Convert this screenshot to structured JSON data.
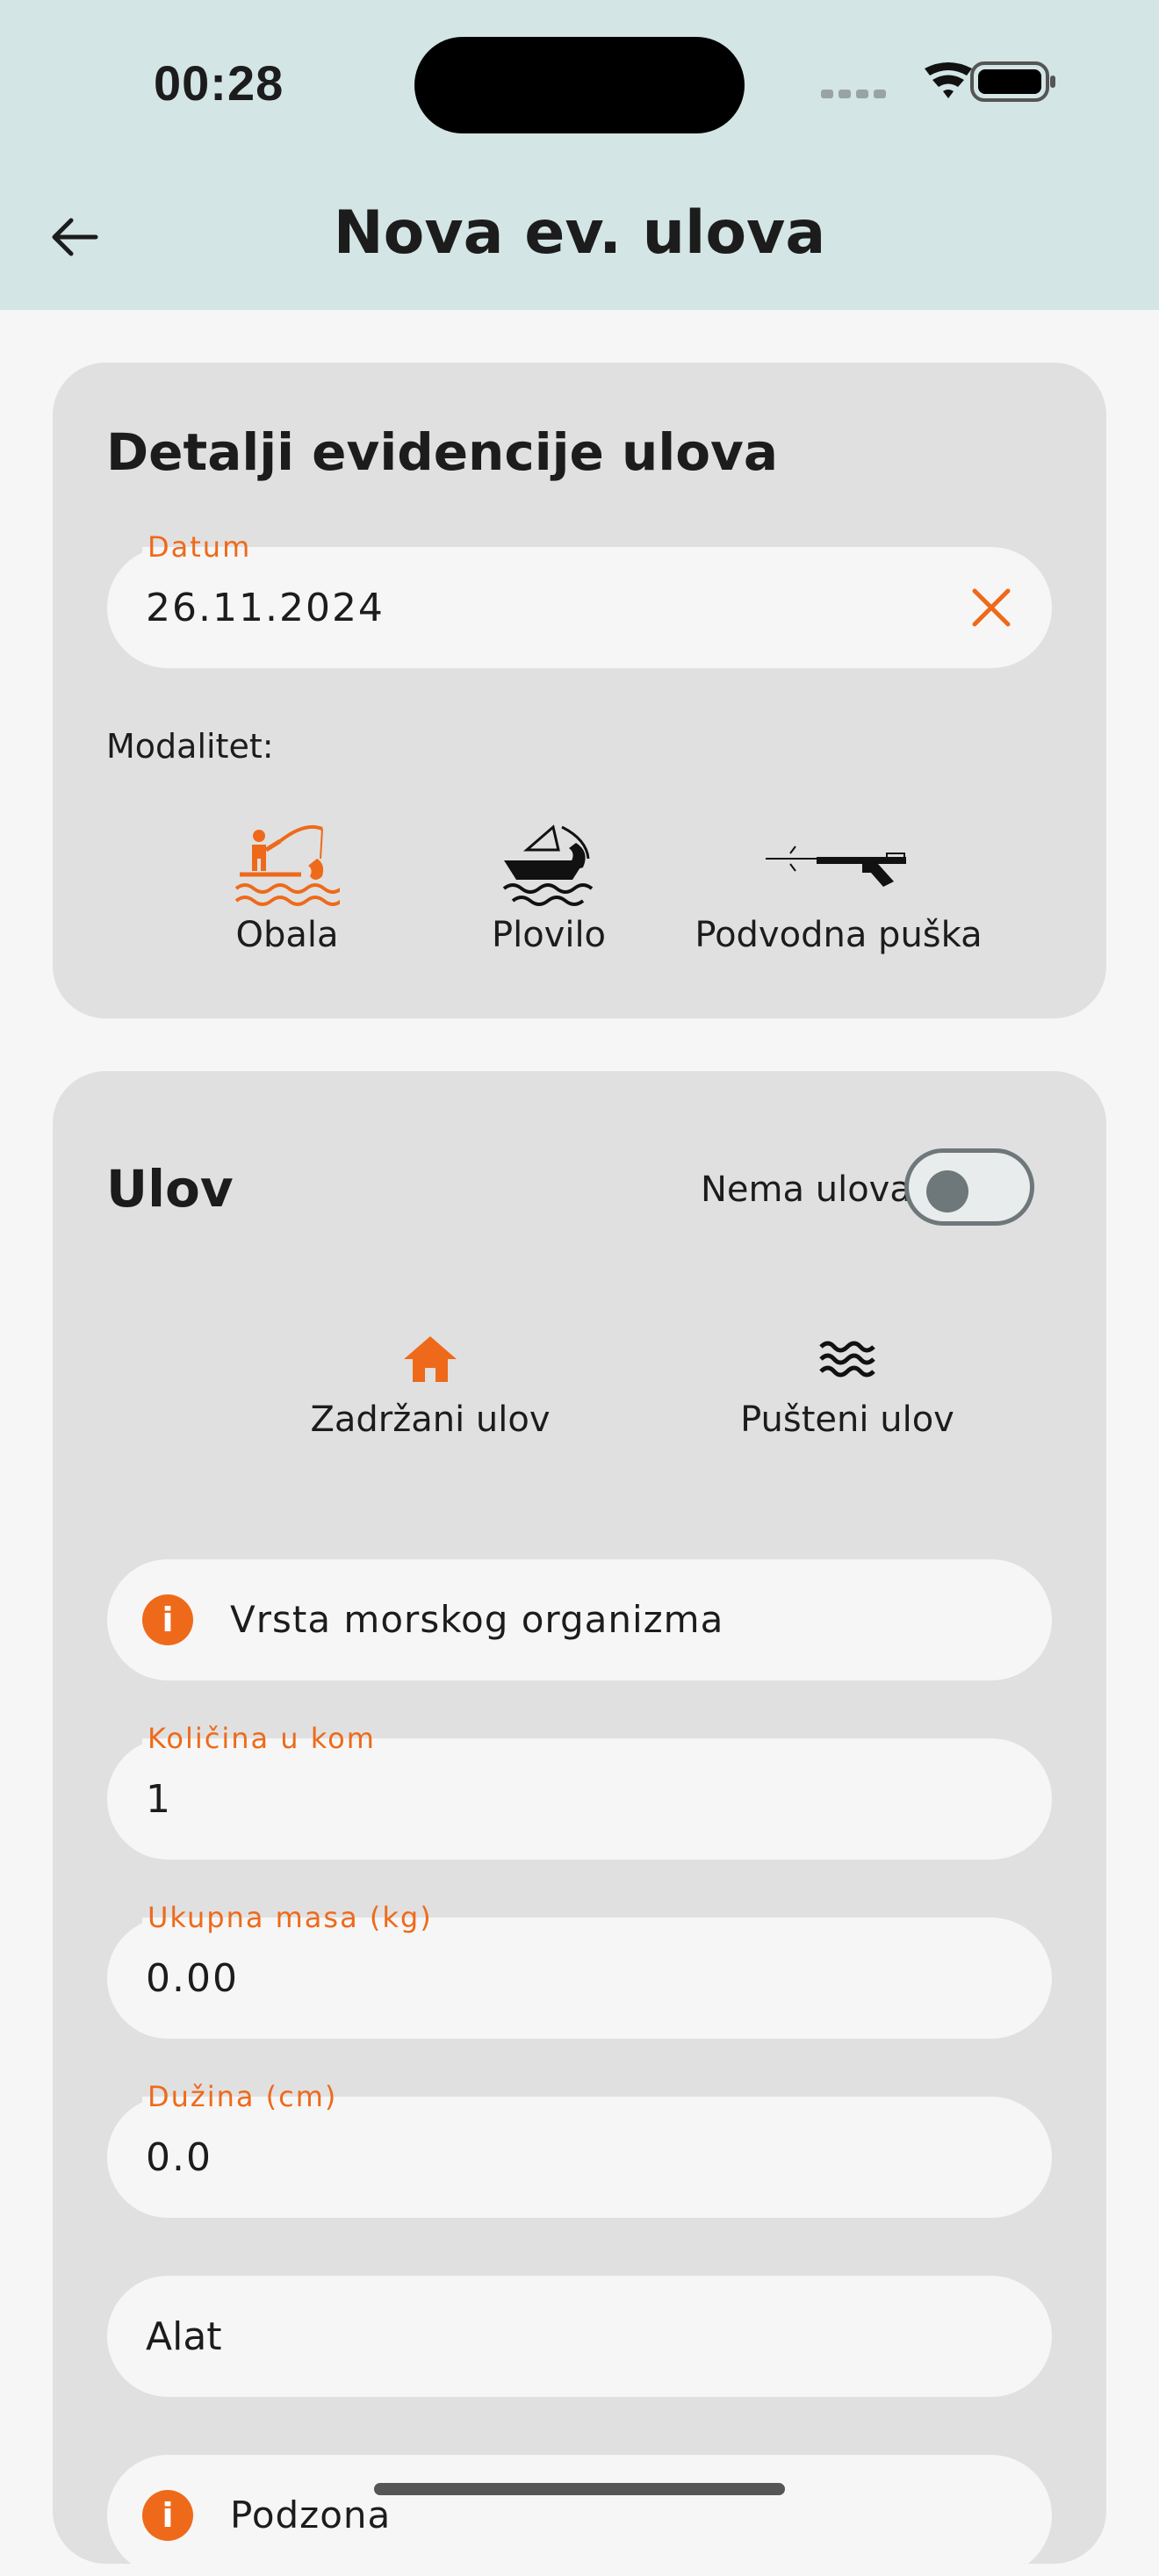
{
  "status_bar": {
    "time": "00:28"
  },
  "nav": {
    "title": "Nova ev. ulova"
  },
  "details_card": {
    "title": "Detalji evidencije ulova",
    "date_field": {
      "label": "Datum",
      "value": "26.11.2024"
    },
    "modalitet_label": "Modalitet:",
    "modes": [
      {
        "label": "Obala",
        "icon": "shore-fishing-icon",
        "selected": true
      },
      {
        "label": "Plovilo",
        "icon": "boat-fishing-icon",
        "selected": false
      },
      {
        "label": "Podvodna puška",
        "icon": "speargun-icon",
        "selected": false
      }
    ]
  },
  "catch_card": {
    "title": "Ulov",
    "no_catch_label": "Nema ulova",
    "no_catch_enabled": false,
    "tabs": [
      {
        "label": "Zadržani ulov",
        "icon": "home-icon",
        "active": true
      },
      {
        "label": "Pušteni ulov",
        "icon": "waves-icon",
        "active": false
      }
    ],
    "species_field": {
      "placeholder": "Vrsta morskog organizma"
    },
    "quantity_field": {
      "label": "Količina u kom",
      "value": "1"
    },
    "mass_field": {
      "label": "Ukupna masa (kg)",
      "value": "0.00"
    },
    "length_field": {
      "label": "Dužina (cm)",
      "value": "0.0"
    },
    "tool_field": {
      "placeholder": "Alat"
    },
    "subzone_field": {
      "placeholder": "Podzona"
    }
  },
  "colors": {
    "accent": "#ee6a1a",
    "header_bg": "#d3e5e4",
    "card_bg": "#e0e0e0",
    "field_bg": "#f6f6f6",
    "page_bg": "#f6f6f6"
  }
}
